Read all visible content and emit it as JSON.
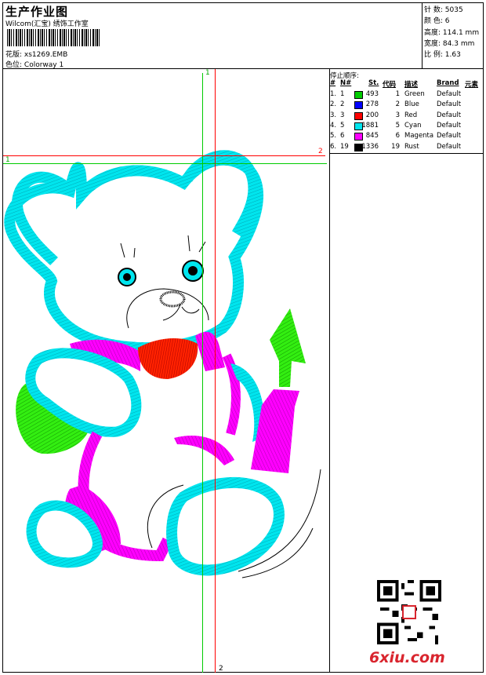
{
  "header": {
    "title": "生产作业图",
    "company": "Wilcom(汇宝) 绣饰工作室",
    "pattern_label": "花版:",
    "pattern_value": "xs1269.EMB",
    "color_label": "色位:",
    "color_value": "Colorway 1"
  },
  "stats": {
    "stitches_label": "针 数:",
    "stitches": "5035",
    "colors_label": "颜 色:",
    "colors": "6",
    "height_label": "高度:",
    "height": "114.1 mm",
    "width_label": "宽度:",
    "width": "84.3 mm",
    "scale_label": "比 例:",
    "scale": "1.63"
  },
  "stop_sequence": {
    "title": "停止顺序:",
    "headers": [
      "#",
      "N#",
      "St.",
      "代码",
      "描述",
      "Brand",
      "元素"
    ],
    "rows": [
      {
        "idx": "1.",
        "n": "1",
        "st": "493",
        "code": "1",
        "desc": "Green",
        "brand": "Default",
        "color": "#00cc00"
      },
      {
        "idx": "2.",
        "n": "2",
        "st": "278",
        "code": "2",
        "desc": "Blue",
        "brand": "Default",
        "color": "#0000ff"
      },
      {
        "idx": "3.",
        "n": "3",
        "st": "200",
        "code": "3",
        "desc": "Red",
        "brand": "Default",
        "color": "#ff0000"
      },
      {
        "idx": "4.",
        "n": "5",
        "st": "1881",
        "code": "5",
        "desc": "Cyan",
        "brand": "Default",
        "color": "#00e5ee"
      },
      {
        "idx": "5.",
        "n": "6",
        "st": "845",
        "code": "6",
        "desc": "Magenta",
        "brand": "Default",
        "color": "#ff00ff"
      },
      {
        "idx": "6.",
        "n": "19",
        "st": "1336",
        "code": "19",
        "desc": "Rust",
        "brand": "Default",
        "color": "#000000"
      }
    ]
  },
  "guides": {
    "vertical_1": "1",
    "vertical_2": "2",
    "horizontal_1": "1",
    "horizontal_2": "2"
  },
  "watermark": "6xiu.com",
  "colors": {
    "green": "#00cc00",
    "red": "#ff0000",
    "cyan": "#00e5ee",
    "magenta": "#ff00ff"
  }
}
